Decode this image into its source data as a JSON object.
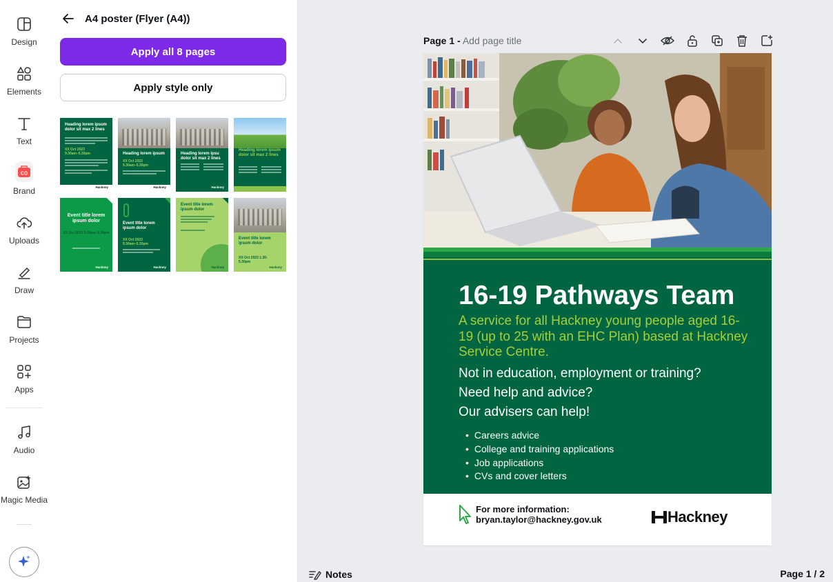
{
  "rail": {
    "items": [
      {
        "label": "Design",
        "icon": "design-icon"
      },
      {
        "label": "Elements",
        "icon": "elements-icon"
      },
      {
        "label": "Text",
        "icon": "text-icon"
      },
      {
        "label": "Brand",
        "icon": "brand-icon"
      },
      {
        "label": "Uploads",
        "icon": "upload-icon"
      },
      {
        "label": "Draw",
        "icon": "draw-icon"
      },
      {
        "label": "Projects",
        "icon": "folder-icon"
      },
      {
        "label": "Apps",
        "icon": "apps-icon"
      },
      {
        "label": "Audio",
        "icon": "music-icon"
      },
      {
        "label": "Magic Media",
        "icon": "magic-media-icon"
      }
    ],
    "brand_badge": "CO"
  },
  "panel": {
    "title": "A4 poster (Flyer (A4))",
    "apply_all_label": "Apply all 8 pages",
    "apply_style_label": "Apply style only",
    "thumbnails": [
      {
        "heading": "Heading lorem ipsum dolor sit max 2 lines",
        "date": "XX Oct 2023 9.30am–5.30pm"
      },
      {
        "heading": "Heading lorem ipsum",
        "date": "XX Oct 2023 9.30am–5.30pm"
      },
      {
        "heading": "Heading lorem ipsu dolor sit max 2 lines",
        "date": ""
      },
      {
        "heading": "Heading lorem ipsum dolor sit max 2 lines",
        "date": ""
      },
      {
        "heading": "Event title lorem ipsum dolor",
        "date": "XX Oct 2023 9.30am–5.30pm"
      },
      {
        "heading": "Event title lorem ipsum dolor",
        "date": "XX Oct 2023 9.30am–5.30pm"
      },
      {
        "heading": "Event title lorem ipsum dolor",
        "date": ""
      },
      {
        "heading": "Event title lorem ipsum dolor",
        "date": "XX Oct 2023 1.30-5.30pm"
      }
    ],
    "thumb_logo": "Hackney"
  },
  "canvas": {
    "page_label": "Page 1 -",
    "page_title_placeholder": "Add page title",
    "tools": [
      "chevron-up-icon",
      "chevron-down-icon",
      "hide-icon",
      "lock-icon",
      "duplicate-icon",
      "trash-icon",
      "add-page-icon"
    ],
    "notes_label": "Notes",
    "page_count": "Page 1 / 2"
  },
  "poster": {
    "title": "16-19 Pathways Team",
    "subtitle": "A service for all Hackney young people aged 16-19 (up to 25 with an EHC Plan) based at Hackney Service Centre.",
    "question1": "Not in education, employment or training?",
    "question2": "Need help and advice?",
    "question3": "Our advisers can help!",
    "bullets": [
      "Careers advice",
      "College and training applications",
      "Job applications",
      "CVs and cover letters"
    ],
    "info_label": "For more information:",
    "email": "bryan.taylor@hackney.gov.uk",
    "logo_text": "Hackney"
  },
  "colors": {
    "accent": "#7d2ae8",
    "poster_green": "#006540",
    "poster_lime": "#a6ce39",
    "canvas_bg": "#ebecf0"
  }
}
